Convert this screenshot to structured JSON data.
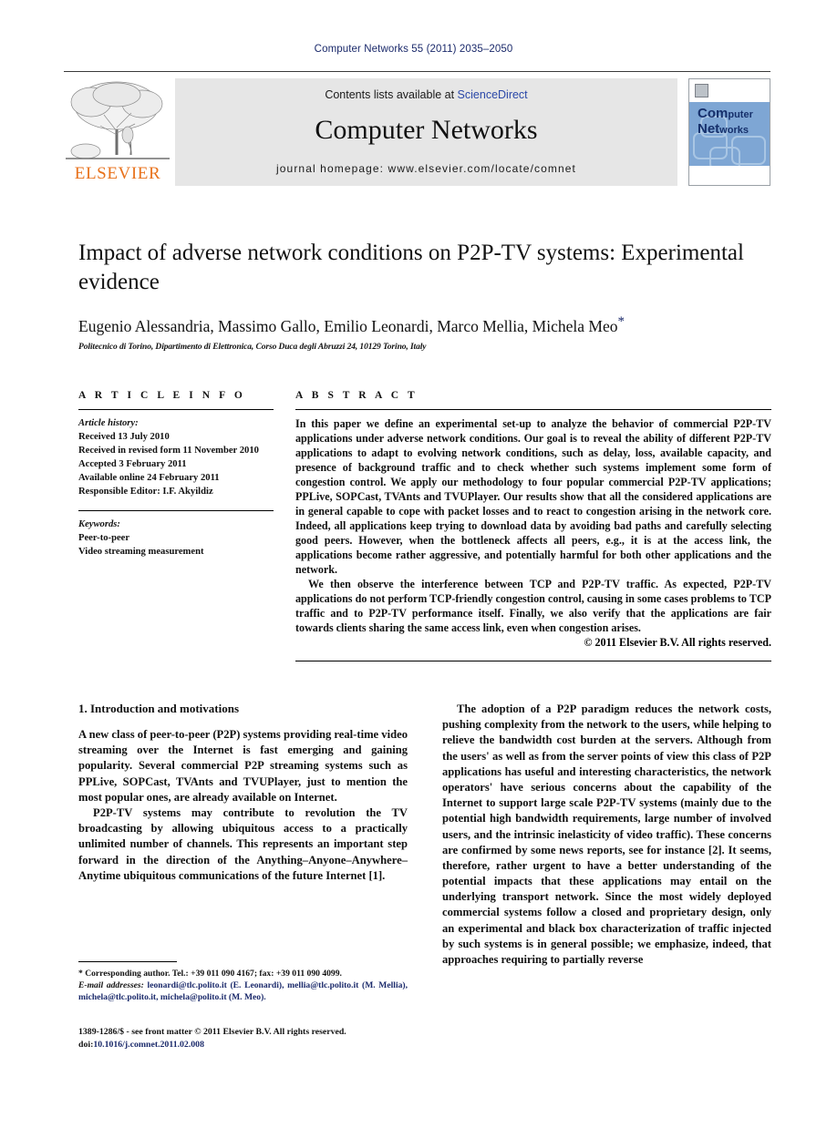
{
  "running_head": "Computer Networks 55 (2011) 2035–2050",
  "masthead": {
    "publisher_name": "ELSEVIER",
    "contents_prefix": "Contents lists available at ",
    "contents_link": "ScienceDirect",
    "journal_title": "Computer Networks",
    "homepage": "journal homepage: www.elsevier.com/locate/comnet",
    "cover": {
      "line1": "Com",
      "line1b": "puter",
      "line2": "Net",
      "line2b": "works"
    }
  },
  "title": "Impact of adverse network conditions on P2P-TV systems: Experimental evidence",
  "authors": "Eugenio Alessandria, Massimo Gallo, Emilio Leonardi, Marco Mellia, Michela Meo",
  "author_marker": "*",
  "affiliation": "Politecnico di Torino, Dipartimento di Elettronica, Corso Duca degli Abruzzi 24, 10129 Torino, Italy",
  "article_info": {
    "heading": "A R T I C L E   I N F O",
    "history_label": "Article history:",
    "history": [
      "Received 13 July 2010",
      "Received in revised form 11 November 2010",
      "Accepted 3 February 2011",
      "Available online 24 February 2011",
      "Responsible Editor: I.F. Akyildiz"
    ],
    "keywords_label": "Keywords:",
    "keywords": [
      "Peer-to-peer",
      "Video streaming measurement"
    ]
  },
  "abstract": {
    "heading": "A B S T R A C T",
    "paragraphs": [
      "In this paper we define an experimental set-up to analyze the behavior of commercial P2P-TV applications under adverse network conditions. Our goal is to reveal the ability of different P2P-TV applications to adapt to evolving network conditions, such as delay, loss, available capacity, and presence of background traffic and to check whether such systems implement some form of congestion control. We apply our methodology to four popular commercial P2P-TV applications; PPLive, SOPCast, TVAnts and TVUPlayer. Our results show that all the considered applications are in general capable to cope with packet losses and to react to congestion arising in the network core. Indeed, all applications keep trying to download data by avoiding bad paths and carefully selecting good peers. However, when the bottleneck affects all peers, e.g., it is at the access link, the applications become rather aggressive, and potentially harmful for both other applications and the network.",
      "We then observe the interference between TCP and P2P-TV traffic. As expected, P2P-TV applications do not perform TCP-friendly congestion control, causing in some cases problems to TCP traffic and to P2P-TV performance itself. Finally, we also verify that the applications are fair towards clients sharing the same access link, even when congestion arises."
    ],
    "copyright": "© 2011 Elsevier B.V. All rights reserved."
  },
  "body": {
    "section_number_title": "1. Introduction and motivations",
    "left_paragraphs": [
      "A new class of peer-to-peer (P2P) systems providing real-time video streaming over the Internet is fast emerging and gaining popularity. Several commercial P2P streaming systems such as PPLive, SOPCast, TVAnts and TVUPlayer, just to mention the most popular ones, are already available on Internet.",
      "P2P-TV systems may contribute to revolution the TV broadcasting by allowing ubiquitous access to a practically unlimited number of channels. This represents an important step forward in the direction of the Anything–Anyone–Anywhere–Anytime ubiquitous communications of the future Internet [1]."
    ],
    "right_paragraph_head": "The adoption of a P2P paradigm reduces the network costs, pushing complexity from the network to the users, while helping to relieve the bandwidth cost burden at the servers. Although from the users' as well as from the server points of view this class of P2P applications has useful and interesting characteristics, the network operators' have serious concerns about the capability of the Internet to support large scale P2P-TV systems (mainly due to the potential high bandwidth requirements, large number of involved users, and the intrinsic inelasticity of video traffic). These concerns are confirmed by some news reports, see for instance [2]. It seems, therefore, rather urgent to have a better understanding of the potential impacts that these applications may entail on the underlying transport network. Since the most widely deployed commercial systems follow a closed and proprietary design, only an experimental and black box characterization of traffic injected by such systems is in general possible; we emphasize, indeed, that approaches requiring to partially reverse"
  },
  "footnote": {
    "corresponding": "* Corresponding author. Tel.: +39 011 090 4167; fax: +39 011 090 4099.",
    "email_label": "E-mail addresses:",
    "emails": "leonardi@tlc.polito.it (E. Leonardi), mellia@tlc.polito.it (M. Mellia), michela@tlc.polito.it, michela@polito.it (M. Meo)."
  },
  "imprint": {
    "line1": "1389-1286/$ - see front matter © 2011 Elsevier B.V. All rights reserved.",
    "doi_prefix": "doi:",
    "doi": "10.1016/j.comnet.2011.02.008"
  }
}
